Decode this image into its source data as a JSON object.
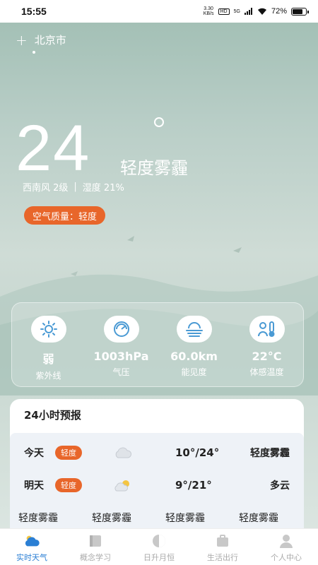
{
  "status_bar": {
    "time": "15:55",
    "net_speed": "3.30\nKB/s",
    "hd": "HD",
    "signal": "5G",
    "battery": "72%"
  },
  "location": {
    "city": "北京市"
  },
  "current": {
    "temperature": "24",
    "condition": "轻度雾霾",
    "wind": "西南风 2级",
    "separator": "|",
    "humidity": "湿度 21%",
    "aqi_label": "空气质量：轻度"
  },
  "metrics": [
    {
      "icon": "sun-icon",
      "value": "弱",
      "label": "紫外线"
    },
    {
      "icon": "gauge-icon",
      "value": "1003hPa",
      "label": "气压"
    },
    {
      "icon": "fog-icon",
      "value": "60.0km",
      "label": "能见度"
    },
    {
      "icon": "thermometer-person-icon",
      "value": "22°C",
      "label": "体感温度"
    }
  ],
  "forecast": {
    "title": "24小时预报",
    "days": [
      {
        "name": "今天",
        "badge": "轻度",
        "icon": "cloud-icon",
        "temp": "10°/24°",
        "condition": "轻度雾霾"
      },
      {
        "name": "明天",
        "badge": "轻度",
        "icon": "partly-cloudy-icon",
        "temp": "9°/21°",
        "condition": "多云"
      }
    ],
    "hourly_conditions": [
      "轻度雾霾",
      "轻度雾霾",
      "轻度雾霾",
      "轻度雾霾"
    ]
  },
  "tabs": [
    {
      "label": "实时天气",
      "icon": "weather-icon",
      "active": true
    },
    {
      "label": "概念学习",
      "icon": "book-icon",
      "active": false
    },
    {
      "label": "日升月恒",
      "icon": "sun-moon-icon",
      "active": false
    },
    {
      "label": "生活出行",
      "icon": "briefcase-icon",
      "active": false
    },
    {
      "label": "个人中心",
      "icon": "user-icon",
      "active": false
    }
  ],
  "colors": {
    "accent": "#e8662a",
    "tab_active": "#2b7fd4"
  }
}
